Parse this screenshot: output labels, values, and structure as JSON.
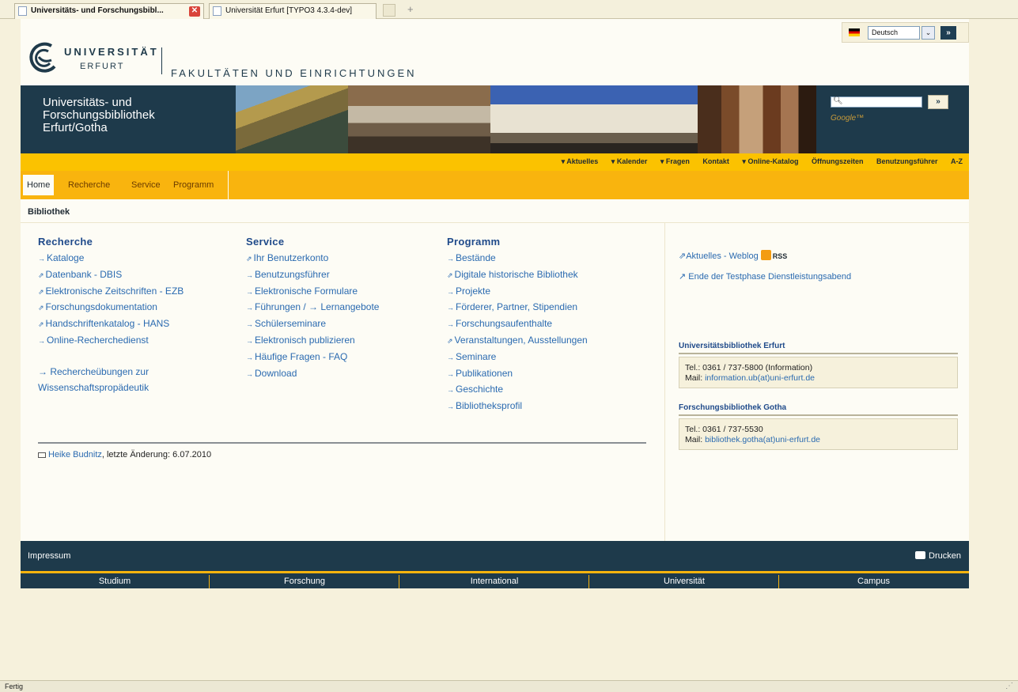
{
  "browser": {
    "tabs": [
      {
        "label": "Universitäts- und Forschungsbibl...",
        "close": "✕"
      },
      {
        "label": "Universität Erfurt [TYPO3 4.3.4-dev]"
      }
    ],
    "new_tab_symbol": "+",
    "status": "Fertig"
  },
  "header": {
    "logo_university": "UNIVERSITÄT",
    "logo_city": "ERFURT",
    "faculty": "FAKULTÄTEN UND EINRICHTUNGEN",
    "language": {
      "selected": "Deutsch",
      "arrow": "⌄",
      "go": "»"
    },
    "banner_title_lines": [
      "Universitäts- und",
      "Forschungsbibliothek",
      "Erfurt/Gotha"
    ],
    "search": {
      "icon": "search-icon",
      "button": "»",
      "brand": "Google™"
    }
  },
  "topnav": [
    "▾ Aktuelles",
    "▾ Kalender",
    "▾ Fragen",
    "Kontakt",
    "▾ Online-Katalog",
    "Öffnungszeiten",
    "Benutzungsführer",
    "A-Z"
  ],
  "mainnav": [
    "Home",
    "Recherche",
    "Service",
    "Programm"
  ],
  "breadcrumb": "Bibliothek",
  "columns": [
    {
      "title": "Recherche",
      "links": [
        {
          "prefix": "→",
          "text": "Kataloge"
        },
        {
          "prefix": "⇗",
          "text": "Datenbank - DBIS"
        },
        {
          "prefix": "⇗",
          "text": "Elektronische Zeitschriften - EZB"
        },
        {
          "prefix": "⇗",
          "text": "Forschungsdokumentation"
        },
        {
          "prefix": "⇗",
          "text": "Handschriftenkatalog - HANS"
        },
        {
          "prefix": "→",
          "text": "Online-Recherchedienst"
        }
      ],
      "extra": [
        "→ Rechercheübungen zur",
        "Wissenschaftspropädeutik"
      ]
    },
    {
      "title": "Service",
      "links": [
        {
          "prefix": "⇗",
          "text": "Ihr Benutzerkonto"
        },
        {
          "prefix": "→",
          "text": "Benutzungsführer"
        },
        {
          "prefix": "→",
          "text": "Elektronische Formulare"
        },
        {
          "prefix": "→",
          "text": "Führungen / → Lernangebote"
        },
        {
          "prefix": "→",
          "text": "Schülerseminare"
        },
        {
          "prefix": "→",
          "text": "Elektronisch publizieren"
        },
        {
          "prefix": "→",
          "text": "Häufige Fragen - FAQ"
        },
        {
          "prefix": "→",
          "text": "Download"
        }
      ]
    },
    {
      "title": "Programm",
      "links": [
        {
          "prefix": "→",
          "text": "Bestände"
        },
        {
          "prefix": "⇗",
          "text": "Digitale historische Bibliothek"
        },
        {
          "prefix": "→",
          "text": "Projekte"
        },
        {
          "prefix": "→",
          "text": "Förderer, Partner, Stipendien"
        },
        {
          "prefix": "→",
          "text": "Forschungsaufenthalte"
        },
        {
          "prefix": "⇗",
          "text": "Veranstaltungen, Ausstellungen"
        },
        {
          "prefix": "→",
          "text": "Seminare"
        },
        {
          "prefix": "→",
          "text": "Publikationen"
        },
        {
          "prefix": "→",
          "text": "Geschichte"
        },
        {
          "prefix": "→",
          "text": "Bibliotheksprofil"
        }
      ]
    }
  ],
  "author": {
    "name": "Heike Budnitz",
    "suffix": ", letzte Änderung: 6.07.2010"
  },
  "sidebar": {
    "blog": "⇗Aktuelles - Weblog",
    "rss": "RSS",
    "news": "↗ Ende der Testphase Dienstleistungsabend",
    "erfurt": {
      "title": "Universitätsbibliothek Erfurt",
      "tel": "Tel.: 0361 / 737-5800 (Information)",
      "mail_label": "Mail: ",
      "mail": "information.ub(at)uni-erfurt.de"
    },
    "gotha": {
      "title": "Forschungsbibliothek Gotha",
      "tel": "Tel.: 0361 / 737-5530",
      "mail_label": "Mail: ",
      "mail": "bibliothek.gotha(at)uni-erfurt.de"
    }
  },
  "footer": {
    "impressum": "Impressum",
    "print": "Drucken",
    "nav": [
      "Studium",
      "Forschung",
      "International",
      "Universität",
      "Campus"
    ]
  },
  "colors": {
    "navy": "#1e3a4b",
    "yellow": "#fbc200",
    "orange": "#f9b40e",
    "link": "#2a6ab0",
    "background": "#f6f1dc"
  }
}
